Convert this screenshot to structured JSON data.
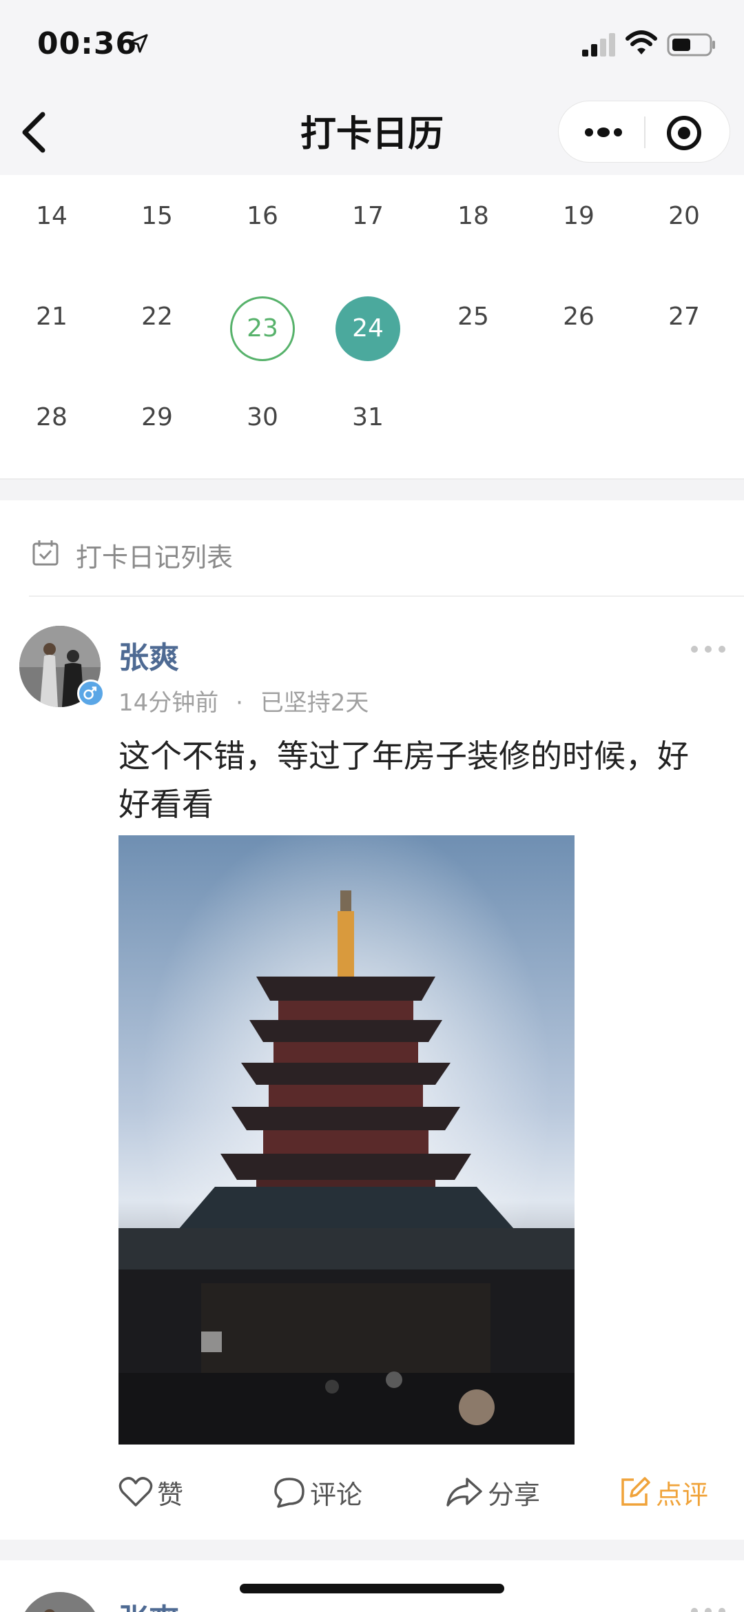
{
  "status_bar": {
    "time": "00:36"
  },
  "nav": {
    "title": "打卡日历"
  },
  "calendar": {
    "rows": [
      [
        "14",
        "15",
        "16",
        "17",
        "18",
        "19",
        "20"
      ],
      [
        "21",
        "22",
        "23",
        "24",
        "25",
        "26",
        "27"
      ],
      [
        "28",
        "29",
        "30",
        "31"
      ]
    ],
    "checked_day": "23",
    "selected_day": "24"
  },
  "list": {
    "header": "打卡日记列表"
  },
  "post": {
    "author": "张爽",
    "time_ago": "14分钟前",
    "separator": "·",
    "streak": "已坚持2天",
    "text": "这个不错，等过了年房子装修的时候，好好看看",
    "actions": {
      "like": "赞",
      "comment": "评论",
      "share": "分享",
      "review": "点评"
    }
  },
  "next_post": {
    "author": "张爽"
  },
  "colors": {
    "accent_teal": "#4ba99d",
    "ring_green": "#57b26b",
    "author_blue": "#4e6a93",
    "review_orange": "#f0a33a",
    "gender_badge_blue": "#5aa6e6"
  },
  "icons": [
    "location-arrow-icon",
    "signal-icon",
    "wifi-icon",
    "battery-icon",
    "back-chevron-icon",
    "more-dots-icon",
    "close-target-icon",
    "calendar-check-icon",
    "male-icon",
    "heart-icon",
    "comment-bubble-icon",
    "share-arrow-icon",
    "edit-note-icon"
  ]
}
